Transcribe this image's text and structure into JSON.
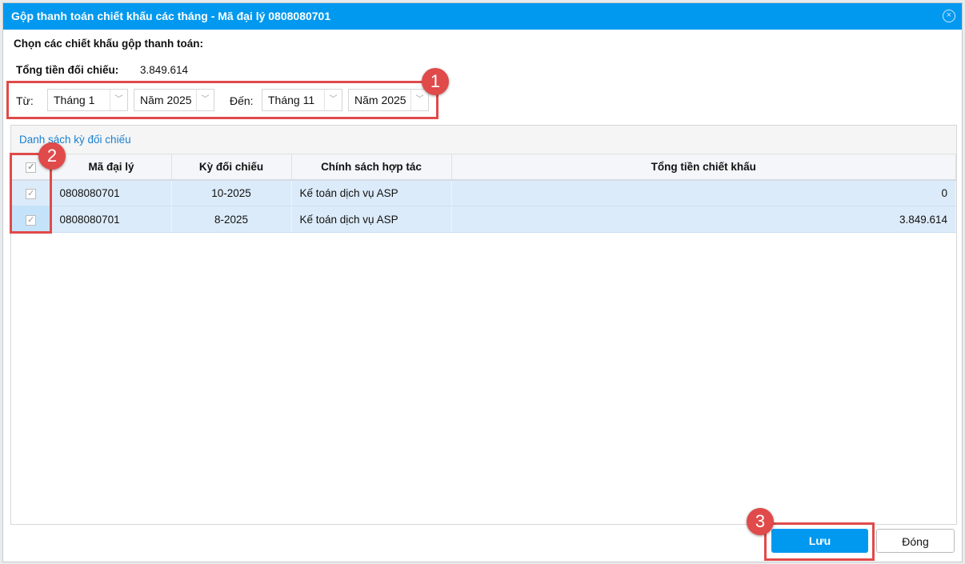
{
  "dialog": {
    "title": "Gộp thanh toán chiết khấu các tháng - Mã đại lý 0808080701",
    "close_icon": "×"
  },
  "prompt": "Chọn các chiết khấu gộp thanh toán:",
  "total": {
    "label": "Tổng tiền đối chiếu:",
    "value": "3.849.614"
  },
  "filter": {
    "from_label": "Từ:",
    "from_month": "Tháng 1",
    "from_year": "Năm 2025",
    "to_label": "Đến:",
    "to_month": "Tháng 11",
    "to_year": "Năm 2025"
  },
  "grid": {
    "title": "Danh sách kỳ đối chiếu",
    "columns": [
      "Mã đại lý",
      "Kỳ đối chiếu",
      "Chính sách hợp tác",
      "Tổng tiền chiết khấu"
    ],
    "rows": [
      {
        "checked": true,
        "ma": "0808080701",
        "ky": "10-2025",
        "chinh_sach": "Kế toán dịch vụ ASP",
        "tong": "0"
      },
      {
        "checked": true,
        "ma": "0808080701",
        "ky": "8-2025",
        "chinh_sach": "Kế toán dịch vụ ASP",
        "tong": "3.849.614"
      }
    ]
  },
  "buttons": {
    "save": "Lưu",
    "close": "Đóng"
  },
  "annotations": [
    "1",
    "2",
    "3"
  ],
  "colors": {
    "header": "#0099ef",
    "annotation": "#e04a4a",
    "row_selected": "#dcebf9"
  }
}
